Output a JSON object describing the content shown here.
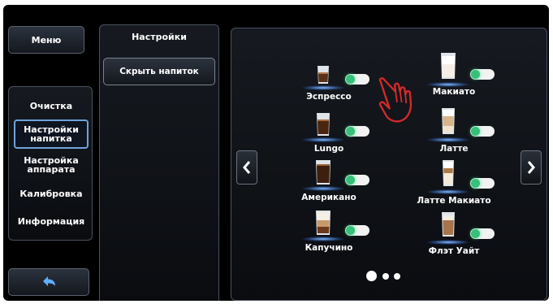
{
  "menu_button": "Меню",
  "submenu": {
    "settings": "Настройки",
    "hide_drink": "Скрыть напиток"
  },
  "nav": [
    {
      "label": "Очистка"
    },
    {
      "label": "Настройки напитка",
      "active": true
    },
    {
      "label": "Настройка аппарата"
    },
    {
      "label": "Калибровка"
    },
    {
      "label": "Информация"
    }
  ],
  "drinks": [
    {
      "name": "Эспрессо",
      "enabled": true,
      "glass": "espresso"
    },
    {
      "name": "Макиато",
      "enabled": true,
      "glass": "macchiato"
    },
    {
      "name": "Lungo",
      "enabled": true,
      "glass": "lungo"
    },
    {
      "name": "Латте",
      "enabled": true,
      "glass": "latte"
    },
    {
      "name": "Американо",
      "enabled": true,
      "glass": "americano"
    },
    {
      "name": "Латте Макиато",
      "enabled": true,
      "glass": "latte-macchiato"
    },
    {
      "name": "Капучино",
      "enabled": true,
      "glass": "cappuccino"
    },
    {
      "name": "Флэт Уайт",
      "enabled": true,
      "glass": "flat-white"
    }
  ],
  "pagination": {
    "pages": 3,
    "current": 1
  },
  "icons": {
    "back": "back-arrow-icon",
    "prev": "chevron-left-icon",
    "next": "chevron-right-icon",
    "hand": "hand-pointer-icon"
  },
  "colors": {
    "accent": "#6fa3d9",
    "toggle_on": "#36c07a",
    "hand": "#d42a2a"
  }
}
